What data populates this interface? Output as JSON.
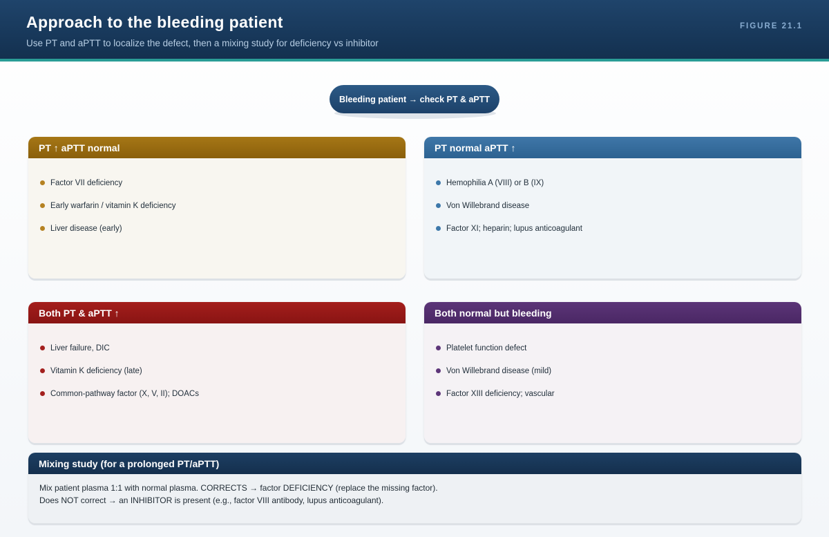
{
  "header": {
    "title": "Approach to the bleeding patient",
    "subtitle": "Use PT and aPTT to localize the defect, then a mixing study for deficiency vs inhibitor",
    "figure_label": "FIGURE 21.1",
    "background_color": "#1a3a5e",
    "accent_rule_color": "#2a9d96"
  },
  "start_node": {
    "label": "Bleeding patient → check PT & aPTT",
    "color": "#245079"
  },
  "cards": [
    {
      "title": "PT ↑ aPTT normal",
      "color": "#9a6c11",
      "items": [
        "Factor VII deficiency",
        "Early warfarin / vitamin K deficiency",
        "Liver disease (early)"
      ]
    },
    {
      "title": "PT normal aPTT ↑",
      "color": "#356c9c",
      "items": [
        "Hemophilia A (VIII) or B (IX)",
        "Von Willebrand disease",
        "Factor XI; heparin; lupus anticoagulant"
      ]
    },
    {
      "title": "Both PT & aPTT ↑",
      "color": "#971918",
      "items": [
        "Liver failure, DIC",
        "Vitamin K deficiency (late)",
        "Common-pathway factor (X, V, II); DOACs"
      ]
    },
    {
      "title": "Both normal but bleeding",
      "color": "#532e6e",
      "items": [
        "Platelet function defect",
        "Von Willebrand disease (mild)",
        "Factor XIII deficiency; vascular"
      ]
    }
  ],
  "mixing_study": {
    "title": "Mixing study (for a prolonged PT/aPTT)",
    "lines": [
      "Mix patient plasma 1:1 with normal plasma. CORRECTS → factor DEFICIENCY (replace the missing factor).",
      "Does NOT correct → an INHIBITOR is present (e.g., factor VIII antibody, lupus anticoagulant)."
    ],
    "color": "#183656"
  }
}
